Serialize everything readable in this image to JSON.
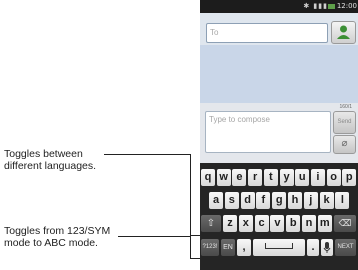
{
  "callouts": {
    "languages": [
      "Toggles between",
      "different languages."
    ],
    "mode": [
      "Toggles from 123/SYM",
      "mode to ABC mode."
    ]
  },
  "status_bar": {
    "clock": "12:00",
    "icons": [
      "bluetooth-icon",
      "signal-icon",
      "battery-icon"
    ]
  },
  "message": {
    "to_placeholder": "To",
    "compose_placeholder": "Type to compose",
    "char_counter": "160/1",
    "send_label": "Send",
    "attach_icon": "paperclip-icon",
    "contact_icon": "contact-icon"
  },
  "keyboard": {
    "row1": [
      "q",
      "w",
      "e",
      "r",
      "t",
      "y",
      "u",
      "i",
      "o",
      "p"
    ],
    "row2": [
      "a",
      "s",
      "d",
      "f",
      "g",
      "h",
      "j",
      "k",
      "l"
    ],
    "row3": [
      "z",
      "x",
      "c",
      "v",
      "b",
      "n",
      "m"
    ],
    "shift_icon": "shift-arrow-icon",
    "backspace_icon": "backspace-icon",
    "mode_key": "?123!",
    "lang_key": "EN",
    "comma_key": ",",
    "period_key": ".",
    "mic_icon": "microphone-icon",
    "next_key": "NEXT"
  },
  "colors": {
    "status_bar": "#1c1c1c",
    "battery": "#5ea04a",
    "contact_accent": "#3c8f35",
    "thread_bg": "#c9d6e8",
    "keyboard_bg": "#252525"
  }
}
